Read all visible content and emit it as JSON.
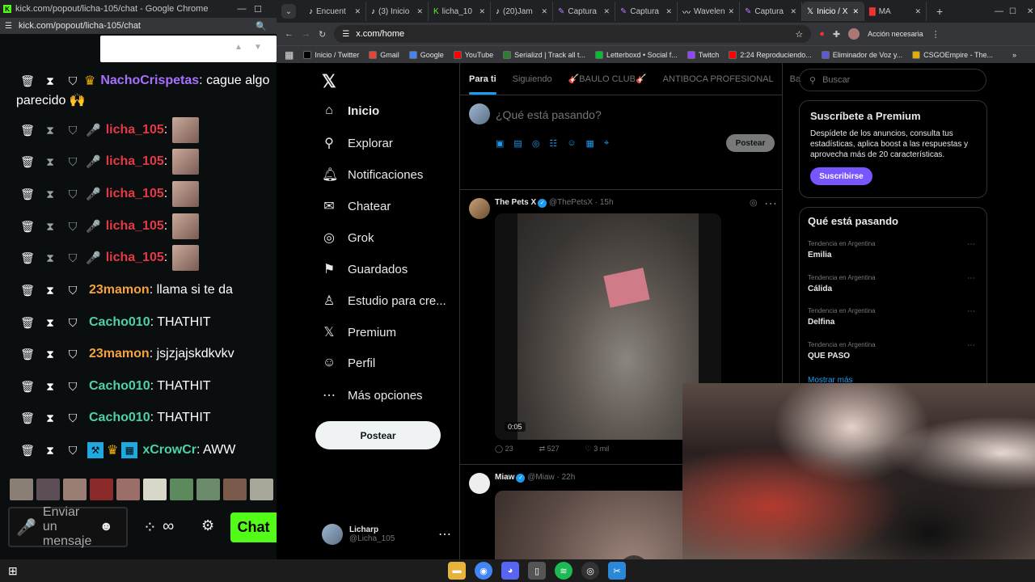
{
  "kick_window": {
    "title": "kick.com/popout/licha-105/chat - Google Chrome",
    "url": "kick.com/popout/licha-105/chat",
    "input_placeholder": "Enviar un mensaje",
    "chat_button": "Chat"
  },
  "chat": [
    {
      "user": "NachoCrispetas",
      "color": "#a970ff",
      "text": ": cague algo",
      "continued": "parecido 🙌"
    },
    {
      "user": "licha_105",
      "color": "#e63946",
      "text": ":"
    },
    {
      "user": "licha_105",
      "color": "#e63946",
      "text": ":"
    },
    {
      "user": "licha_105",
      "color": "#e63946",
      "text": ":"
    },
    {
      "user": "licha_105",
      "color": "#e63946",
      "text": ":"
    },
    {
      "user": "licha_105",
      "color": "#e63946",
      "text": ":"
    },
    {
      "user": "23mamon",
      "color": "#f4a340",
      "text": ": llama si te da"
    },
    {
      "user": "Cacho010",
      "color": "#4fd1a5",
      "text": ": THATHIT"
    },
    {
      "user": "23mamon",
      "color": "#f4a340",
      "text": ": jsjzjajskdkvkv"
    },
    {
      "user": "Cacho010",
      "color": "#4fd1a5",
      "text": ": THATHIT"
    },
    {
      "user": "Cacho010",
      "color": "#4fd1a5",
      "text": ": THATHIT"
    },
    {
      "user": "xCrowCr",
      "color": "#4fd1a5",
      "text": ": AWW"
    }
  ],
  "tabs": [
    {
      "label": "Encuent",
      "icon": "tiktok"
    },
    {
      "label": "(3) Inicio",
      "icon": "tiktok"
    },
    {
      "label": "licha_10",
      "icon": "kick"
    },
    {
      "label": "(20)Jam",
      "icon": "tiktok"
    },
    {
      "label": "Captura",
      "icon": "capture"
    },
    {
      "label": "Captura",
      "icon": "capture"
    },
    {
      "label": "Wavelen",
      "icon": "wave"
    },
    {
      "label": "Captura",
      "icon": "capture"
    },
    {
      "label": "Inicio / X",
      "icon": "x",
      "active": true
    },
    {
      "label": "MA",
      "icon": "ma"
    }
  ],
  "address": {
    "url": "x.com/home",
    "account_button": "Acción necesaria"
  },
  "bookmarks": [
    {
      "label": "Inicio / Twitter",
      "color": "#000000"
    },
    {
      "label": "Gmail",
      "color": "#ea4335"
    },
    {
      "label": "Google",
      "color": "#4285f4"
    },
    {
      "label": "YouTube",
      "color": "#ff0000"
    },
    {
      "label": "Serializd | Track all t...",
      "color": "#2e7d32"
    },
    {
      "label": "Letterboxd • Social f...",
      "color": "#00c030"
    },
    {
      "label": "Twitch",
      "color": "#9146ff"
    },
    {
      "label": "2:24 Reproduciendo...",
      "color": "#ff0000"
    },
    {
      "label": "Eliminador de Voz y...",
      "color": "#5b5bd6"
    },
    {
      "label": "CSGOEmpire - The...",
      "color": "#e0b000"
    }
  ],
  "x_nav": [
    {
      "label": "Inicio",
      "icon": "home-icon",
      "bold": true
    },
    {
      "label": "Explorar",
      "icon": "search-icon"
    },
    {
      "label": "Notificaciones",
      "icon": "bell-icon"
    },
    {
      "label": "Chatear",
      "icon": "mail-icon"
    },
    {
      "label": "Grok",
      "icon": "grok-icon"
    },
    {
      "label": "Guardados",
      "icon": "bookmark-icon"
    },
    {
      "label": "Estudio para cre...",
      "icon": "studio-icon"
    },
    {
      "label": "Premium",
      "icon": "x-logo-icon"
    },
    {
      "label": "Perfil",
      "icon": "person-icon"
    },
    {
      "label": "Más opciones",
      "icon": "more-icon"
    }
  ],
  "post_button": "Postear",
  "profile": {
    "name": "Licharp",
    "handle": "@Licha_105"
  },
  "feed_tabs": [
    "Para ti",
    "Siguiendo",
    "🎸BAULO CLUB🎸",
    "ANTIBOCA PROFESIONAL",
    "Ba"
  ],
  "composer": {
    "placeholder": "¿Qué está pasando?",
    "button": "Postear"
  },
  "posts": [
    {
      "name": "The Pets X",
      "handle": "@ThePetsX",
      "time": "· 15h",
      "video_time": "0:05",
      "replies": "23",
      "reposts": "527",
      "likes": "3 mil"
    },
    {
      "name": "Miaw",
      "handle": "@Miaw",
      "time": "· 22h"
    }
  ],
  "search_placeholder": "Buscar",
  "premium": {
    "title": "Suscríbete a Premium",
    "body": "Despídete de los anuncios, consulta tus estadísticas, aplica boost a las respuestas y aprovecha más de 20 características.",
    "button": "Suscribirse"
  },
  "trends_title": "Qué está pasando",
  "trends": [
    {
      "context": "Tendencia en Argentina",
      "name": "Emilia"
    },
    {
      "context": "Tendencia en Argentina",
      "name": "Cálida"
    },
    {
      "context": "Tendencia en Argentina",
      "name": "Delfina"
    },
    {
      "context": "Tendencia en Argentina",
      "name": "QUE PASO"
    }
  ],
  "show_more": "Mostrar más"
}
